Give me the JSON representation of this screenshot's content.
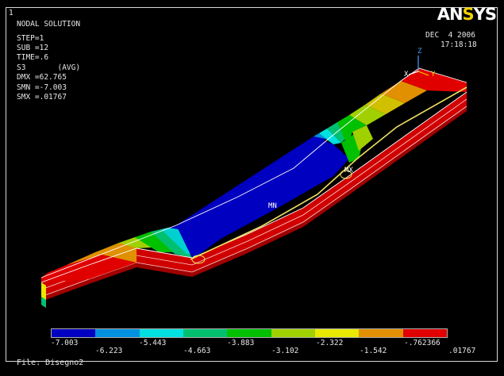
{
  "window_number": "1",
  "header_lines": [
    "NODAL SOLUTION",
    "STEP=1",
    "SUB =12",
    "TIME=.6",
    "S3       (AVG)",
    "DMX =62.765",
    "SMN =-7.003",
    "SMX =.01767"
  ],
  "logo_text": "ANSYS",
  "date": "DEC  4 2006",
  "time": "17:18:18",
  "triad": {
    "z": "Z",
    "x": "X",
    "y": "Y"
  },
  "markers": {
    "min": "MN",
    "max": "MX"
  },
  "legend": {
    "labels": [
      "-7.003",
      "-6.223",
      "-5.443",
      "-4.663",
      "-3.883",
      "-3.102",
      "-2.322",
      "-1.542",
      "-.762366",
      ".01767"
    ],
    "colors": [
      "#0000c0",
      "#0090e0",
      "#00e0e0",
      "#00c070",
      "#00c000",
      "#a0d000",
      "#e8e800",
      "#e09000",
      "#e00000"
    ]
  },
  "footer": "File: Disegno2"
}
